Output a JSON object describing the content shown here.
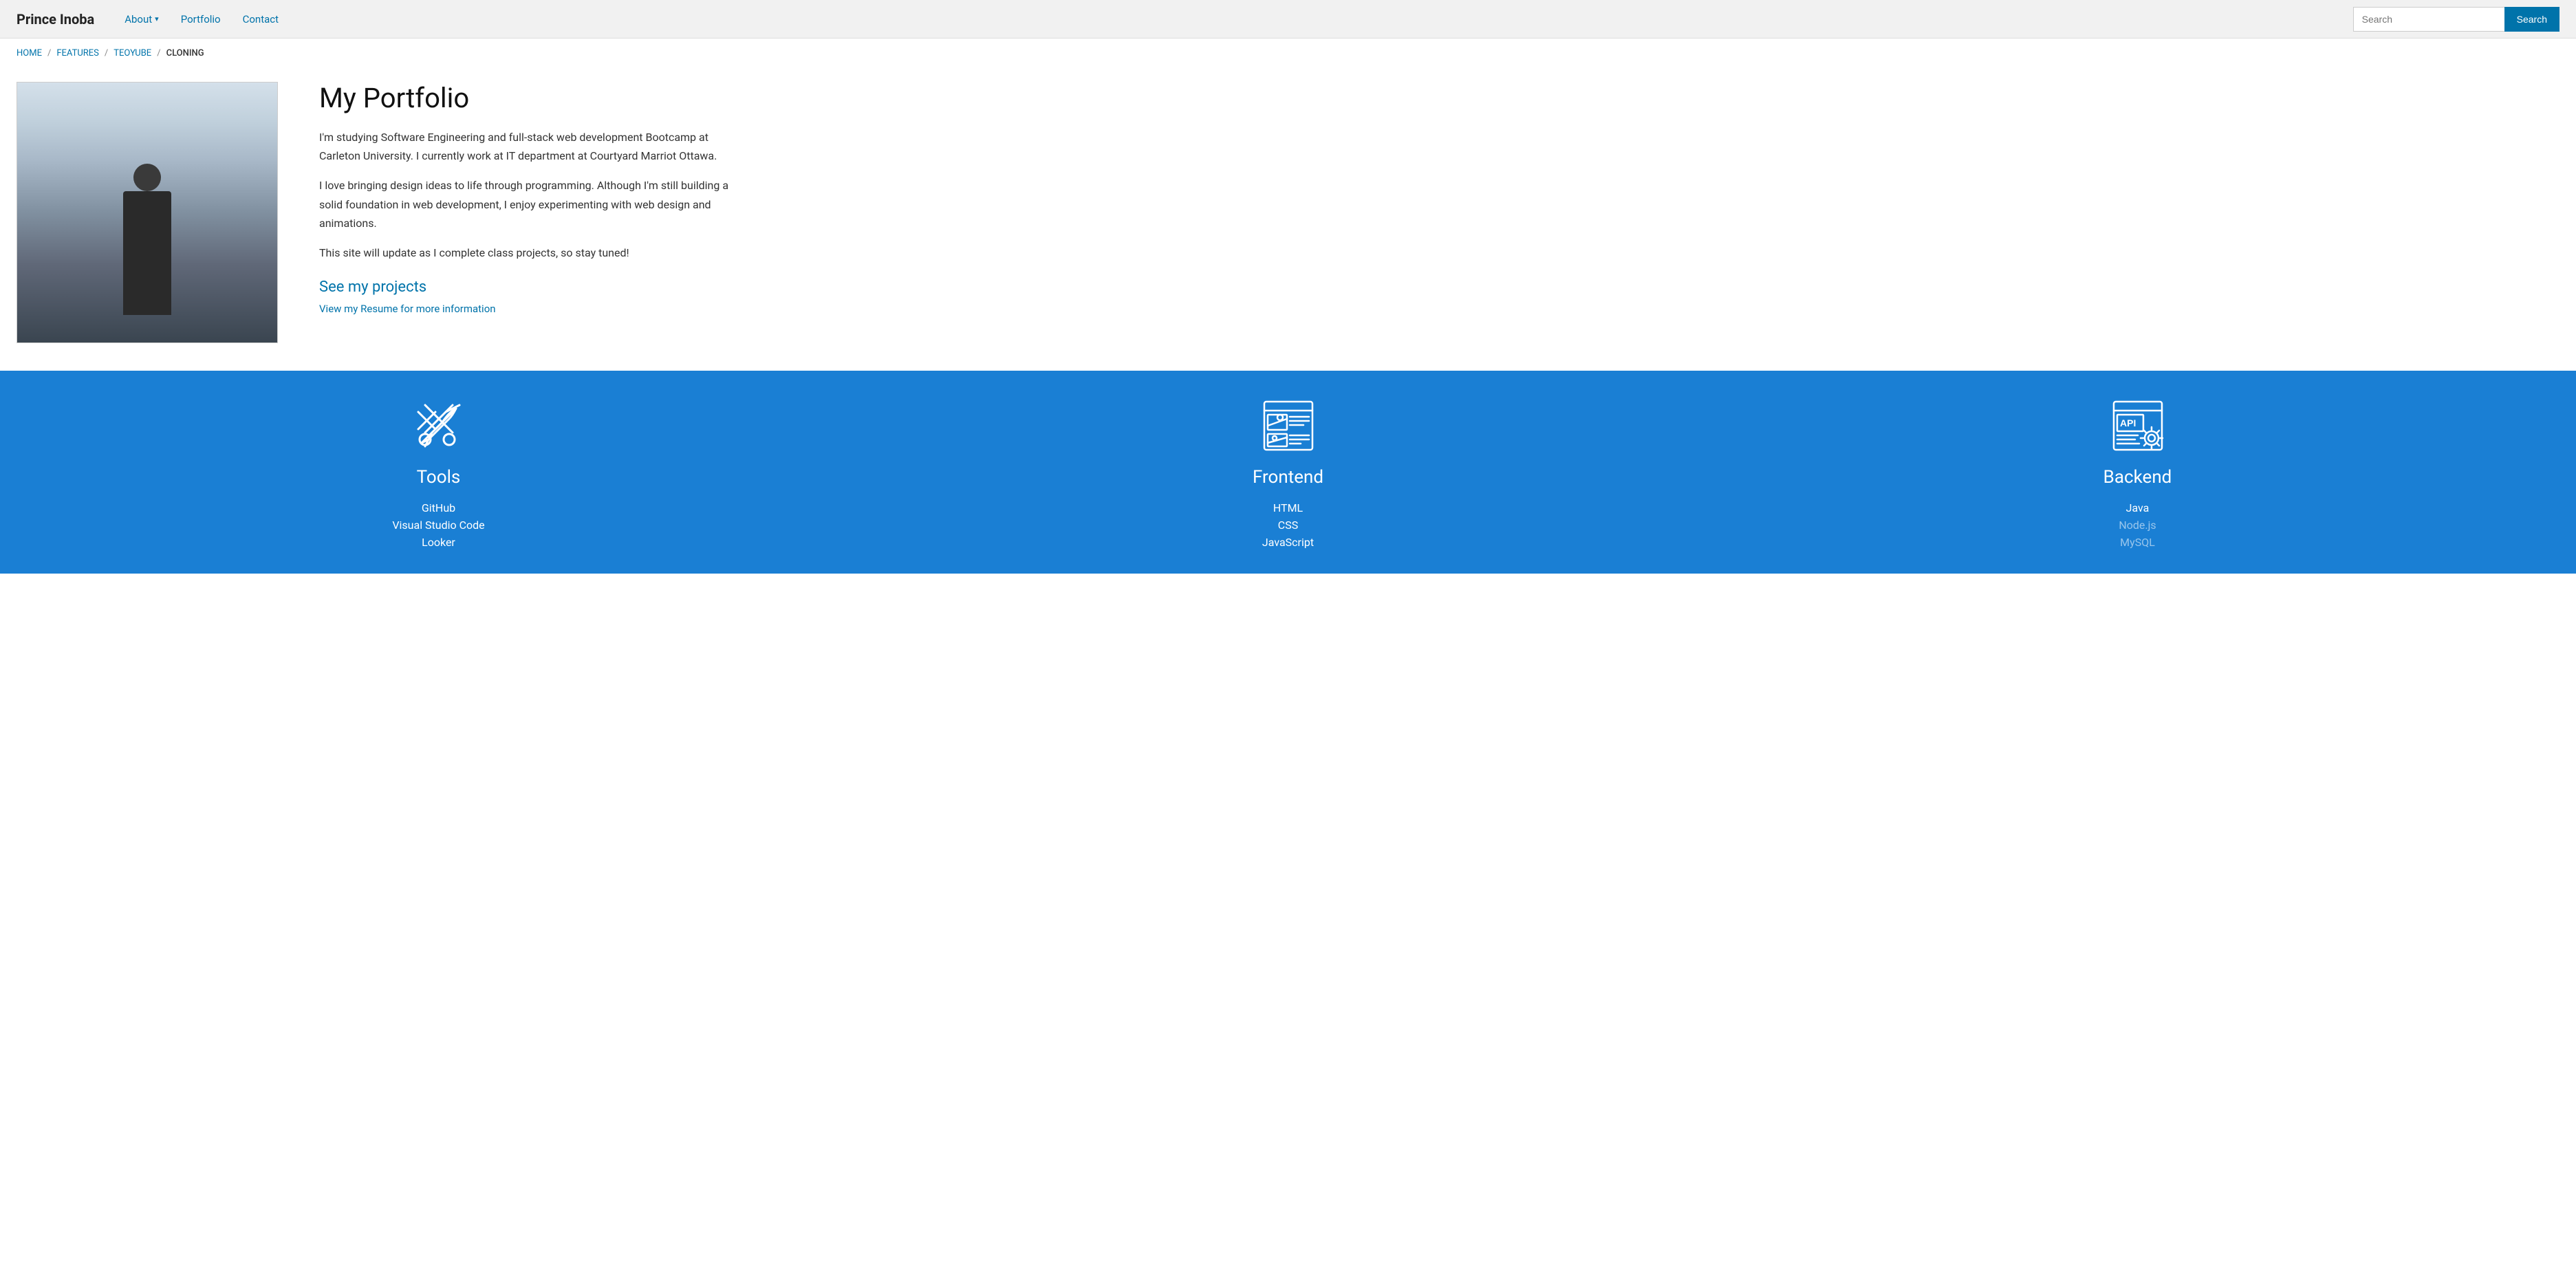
{
  "navbar": {
    "brand": "Prince Inoba",
    "nav_items": [
      {
        "label": "About",
        "has_dropdown": true
      },
      {
        "label": "Portfolio"
      },
      {
        "label": "Contact"
      }
    ],
    "search_placeholder": "Search",
    "search_button_label": "Search"
  },
  "breadcrumb": {
    "items": [
      {
        "label": "HOME",
        "link": true
      },
      {
        "label": "FEATURES",
        "link": true
      },
      {
        "label": "TEOYUBE",
        "link": true
      },
      {
        "label": "CLONING",
        "link": false
      }
    ]
  },
  "portfolio": {
    "title": "My Portfolio",
    "description1": "I'm studying Software Engineering and full-stack web development Bootcamp at Carleton University. I currently work at IT department at Courtyard Marriot Ottawa.",
    "description2": "I love bringing design ideas to life through programming. Although I'm still building a solid foundation in web development, I enjoy experimenting with web design and animations.",
    "description3": "This site will update as I complete class projects, so stay tuned!",
    "see_projects_label": "See my projects",
    "resume_label": "View my Resume for more information"
  },
  "skills": {
    "columns": [
      {
        "title": "Tools",
        "icon_name": "tools-icon",
        "items": [
          {
            "label": "GitHub",
            "dim": false
          },
          {
            "label": "Visual Studio Code",
            "dim": false
          },
          {
            "label": "Looker",
            "dim": false
          }
        ]
      },
      {
        "title": "Frontend",
        "icon_name": "frontend-icon",
        "items": [
          {
            "label": "HTML",
            "dim": false
          },
          {
            "label": "CSS",
            "dim": false
          },
          {
            "label": "JavaScript",
            "dim": false
          }
        ]
      },
      {
        "title": "Backend",
        "icon_name": "backend-icon",
        "items": [
          {
            "label": "Java",
            "dim": false
          },
          {
            "label": "Node.js",
            "dim": true
          },
          {
            "label": "MySQL",
            "dim": true
          }
        ]
      }
    ]
  }
}
